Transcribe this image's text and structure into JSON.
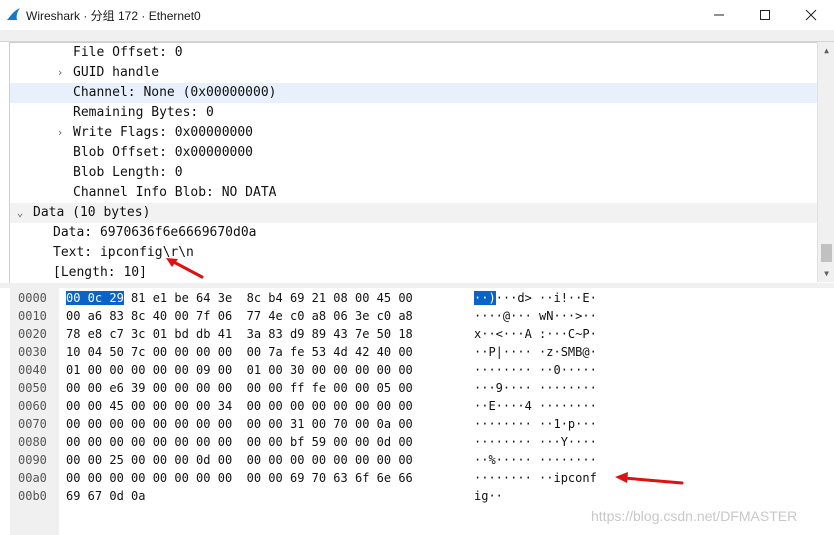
{
  "window": {
    "title": "Wireshark · 分组 172 · Ethernet0",
    "app_icon": "shark-fin-icon",
    "buttons": {
      "minimize": "minimize-icon",
      "maximize": "maximize-icon",
      "close": "close-icon"
    }
  },
  "detail_tree": [
    {
      "text": "File Offset: 0",
      "expandable": false,
      "highlighted": false
    },
    {
      "text": "GUID handle",
      "expandable": true,
      "expander": "›",
      "highlighted": false
    },
    {
      "text": "Channel: None (0x00000000)",
      "expandable": false,
      "highlighted": true
    },
    {
      "text": "Remaining Bytes: 0",
      "expandable": false,
      "highlighted": false
    },
    {
      "text": "Write Flags: 0x00000000",
      "expandable": true,
      "expander": "›",
      "highlighted": false
    },
    {
      "text": "Blob Offset: 0x00000000",
      "expandable": false,
      "highlighted": false
    },
    {
      "text": "Blob Length: 0",
      "expandable": false,
      "highlighted": false
    },
    {
      "text": "Channel Info Blob: NO DATA",
      "expandable": false,
      "highlighted": false
    },
    {
      "text": "Data (10 bytes)",
      "expandable": true,
      "expander": "⌄",
      "expanded": true,
      "highlighted": false
    },
    {
      "text": "Data: 6970636f6e6669670d0a",
      "expandable": false,
      "highlighted": false
    },
    {
      "text": "Text: ipconfig\\r\\n",
      "expandable": false,
      "highlighted": false
    },
    {
      "text": "[Length: 10]",
      "expandable": false,
      "highlighted": false
    }
  ],
  "hex_dump": [
    {
      "offset": "0000",
      "hex": "00 0c 29 81 e1 be 64 3e  8c b4 69 21 08 00 45 00",
      "ascii": "··)···d> ··i!··E·"
    },
    {
      "offset": "0010",
      "hex": "00 a6 83 8c 40 00 7f 06  77 4e c0 a8 06 3e c0 a8",
      "ascii": "····@··· wN···>··"
    },
    {
      "offset": "0020",
      "hex": "78 e8 c7 3c 01 bd db 41  3a 83 d9 89 43 7e 50 18",
      "ascii": "x··<···A :···C~P·"
    },
    {
      "offset": "0030",
      "hex": "10 04 50 7c 00 00 00 00  00 7a fe 53 4d 42 40 00",
      "ascii": "··P|···· ·z·SMB@·"
    },
    {
      "offset": "0040",
      "hex": "01 00 00 00 00 00 09 00  01 00 30 00 00 00 00 00",
      "ascii": "········ ··0·····"
    },
    {
      "offset": "0050",
      "hex": "00 00 e6 39 00 00 00 00  00 00 ff fe 00 00 05 00",
      "ascii": "···9···· ········"
    },
    {
      "offset": "0060",
      "hex": "00 00 45 00 00 00 00 34  00 00 00 00 00 00 00 00",
      "ascii": "··E····4 ········"
    },
    {
      "offset": "0070",
      "hex": "00 00 00 00 00 00 00 00  00 00 31 00 70 00 0a 00",
      "ascii": "········ ··1·p···"
    },
    {
      "offset": "0080",
      "hex": "00 00 00 00 00 00 00 00  00 00 bf 59 00 00 0d 00",
      "ascii": "········ ···Y····"
    },
    {
      "offset": "0090",
      "hex": "00 00 25 00 00 00 0d 00  00 00 00 00 00 00 00 00",
      "ascii": "··%····· ········"
    },
    {
      "offset": "00a0",
      "hex": "00 00 00 00 00 00 00 00  00 00 69 70 63 6f 6e 66",
      "ascii": "········ ··ipconf"
    },
    {
      "offset": "00b0",
      "hex": "69 67 0d 0a",
      "ascii": "ig··"
    }
  ],
  "selection": {
    "hex_prefix": "00 0c 29",
    "ascii_prefix": "··)"
  },
  "watermark": "https://blog.csdn.net/DFMASTER",
  "colors": {
    "selection": "#0a64c8",
    "row_highlight": "#e8f1fb",
    "arrow": "#e01010",
    "offset_gutter": "#f0f0f0"
  }
}
